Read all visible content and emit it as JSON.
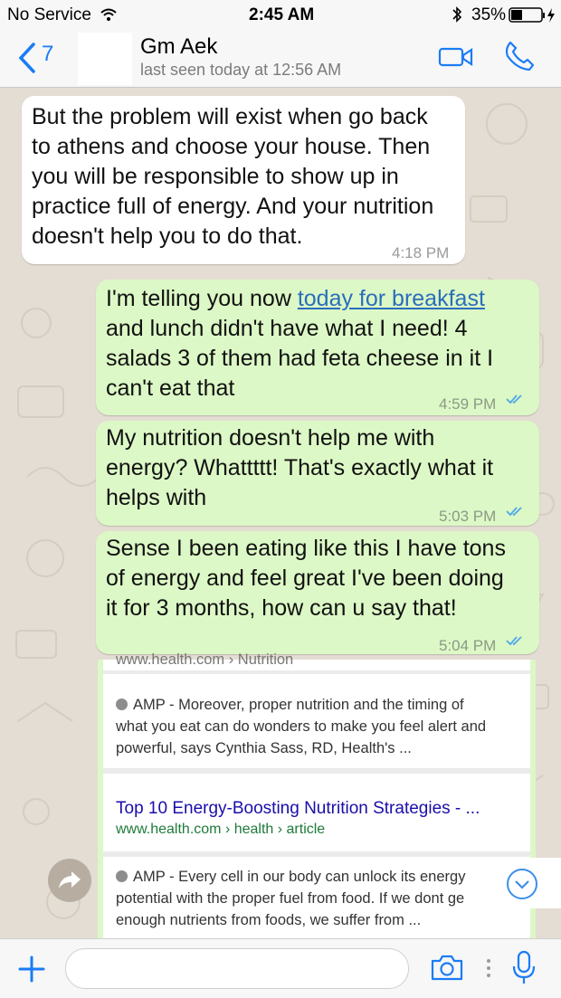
{
  "status": {
    "carrier": "No Service",
    "time": "2:45 AM",
    "battery": "35%"
  },
  "header": {
    "back_count": "7",
    "contact_name": "Gm Aek",
    "last_seen": "last seen today at 12:56 AM"
  },
  "messages": [
    {
      "dir": "in",
      "lines": [
        "But the problem will exist when go back",
        "to athens and choose your house. Then",
        "you will be responsible to show up in",
        "practice full of energy. And your nutrition",
        "doesn't help you to do that."
      ],
      "time": "4:18 PM"
    },
    {
      "dir": "out",
      "line1_prefix": "I'm telling you now ",
      "line1_link": "today for breakfast",
      "lines": [
        "and lunch didn't have what I need! 4",
        "salads 3 of them had feta cheese in it I",
        "can't eat that"
      ],
      "time": "4:59 PM"
    },
    {
      "dir": "out",
      "lines": [
        "My nutrition doesn't help me with",
        "energy? Whattttt! That's exactly what it",
        "helps with"
      ],
      "time": "5:03 PM"
    },
    {
      "dir": "out",
      "lines": [
        "Sense I been eating like this I have tons",
        "of energy and feel great I've been doing",
        "it for 3 months, how can u say that!"
      ],
      "time": "5:04 PM"
    }
  ],
  "search_card": {
    "clipped_url": "www.health.com › Nutrition",
    "result1_snippet": [
      "AMP - Moreover, proper nutrition and the timing of",
      "what you eat can do wonders to make you feel alert and",
      "powerful, says Cynthia Sass, RD, Health's ..."
    ],
    "result2_title": "Top 10 Energy-Boosting Nutrition Strategies - ...",
    "result2_url": "www.health.com › health › article",
    "result2_snippet": [
      "AMP - Every cell in our body can unlock its energy",
      "potential with the proper fuel from food. If we dont ge",
      "enough nutrients from foods, we suffer from ..."
    ]
  },
  "icons": {
    "back": "chevron-left-icon",
    "video": "video-camera-icon",
    "call": "phone-icon",
    "forward": "forward-icon",
    "scroll": "chevron-down-icon",
    "add": "plus-icon",
    "camera": "camera-icon",
    "mic": "microphone-icon"
  },
  "colors": {
    "accent": "#1a7cf5",
    "outgoing": "#dcf8c6",
    "incoming": "#ffffff",
    "tick": "#4fa9e8"
  }
}
